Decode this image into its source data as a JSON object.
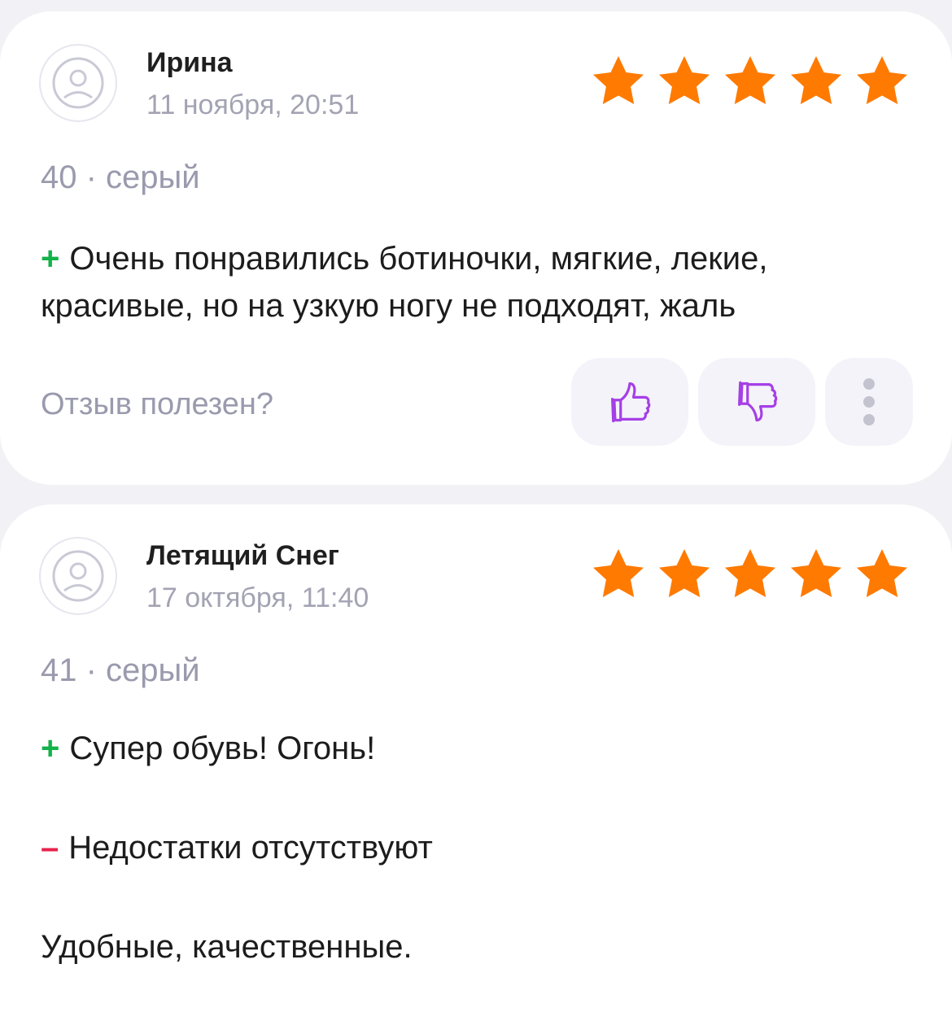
{
  "reviews": [
    {
      "name": "Ирина",
      "date": "11 ноября, 20:51",
      "rating": 5,
      "meta": "40 · серый",
      "pros_sign": "+",
      "pros": "Очень понравились ботиночки, мягкие, лекие, красивые, но на узкую ногу не подходят, жаль",
      "helpful_label": "Отзыв полезен?"
    },
    {
      "name": "Летящий Снег",
      "date": "17 октября, 11:40",
      "rating": 5,
      "meta": "41 · серый",
      "pros_sign": "+",
      "pros": "Супер обувь! Огонь!",
      "cons_sign": "–",
      "cons": "Недостатки отсутствуют",
      "comment": "Удобные, качественные."
    }
  ],
  "icons": {
    "avatar": "sad-face-icon",
    "star": "star-icon",
    "like": "thumbs-up-icon",
    "dislike": "thumbs-down-icon",
    "more": "more-vertical-icon"
  },
  "colors": {
    "star": "#ff7a00",
    "plus": "#13b24a",
    "minus": "#e8214c",
    "accent": "#a53fe6",
    "muted": "#9a9aae"
  }
}
